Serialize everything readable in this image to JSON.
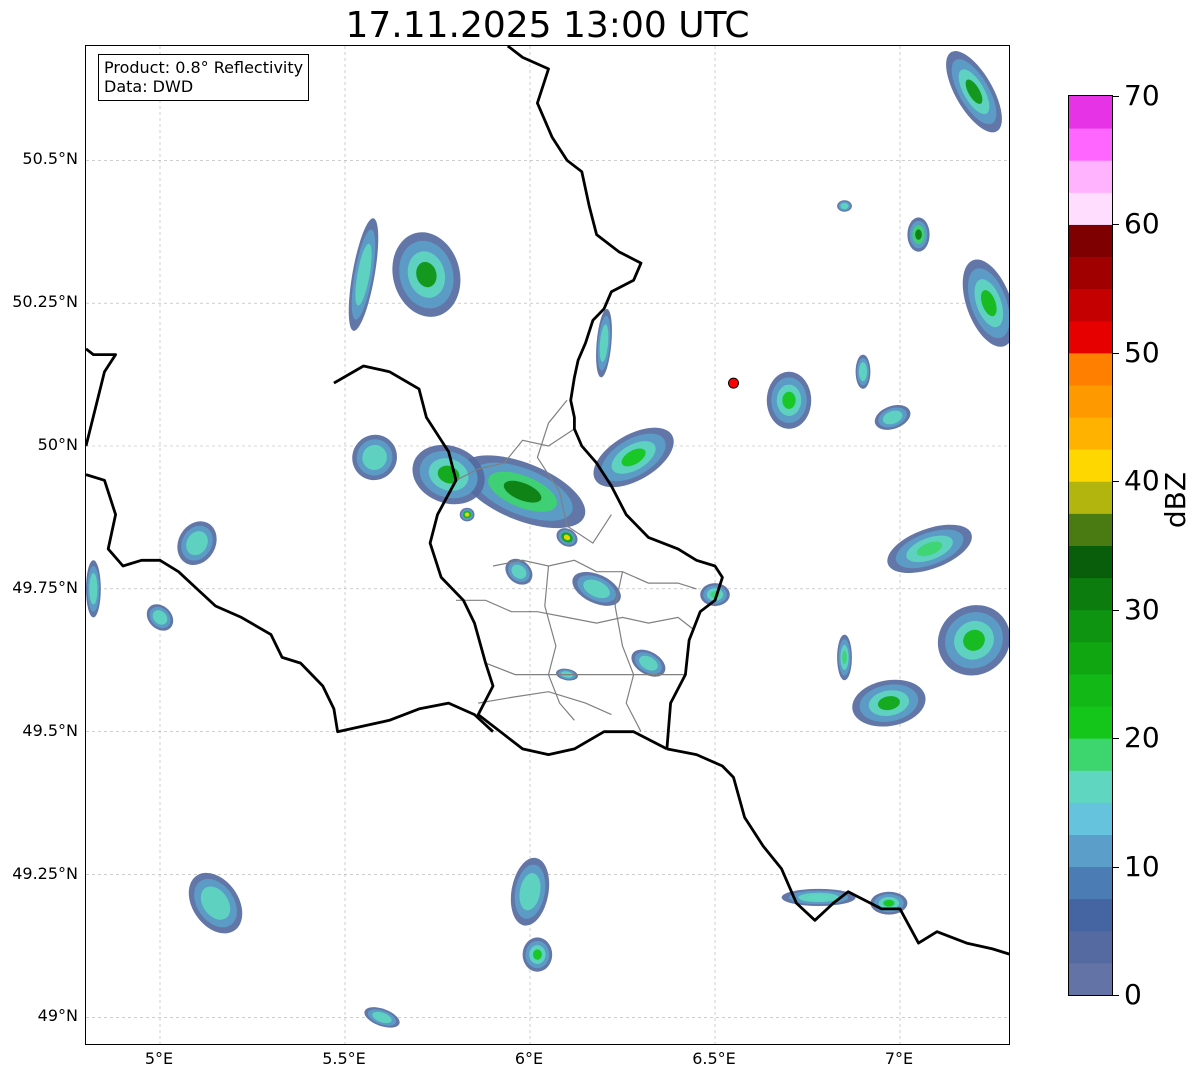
{
  "title": "17.11.2025 13:00 UTC",
  "info": {
    "product": "Product: 0.8° Reflectivity",
    "source": "Data: DWD"
  },
  "map": {
    "extent": {
      "lon": [
        4.8,
        7.3
      ],
      "lat": [
        48.95,
        50.7
      ]
    },
    "lat_ticks": [
      {
        "value": 49.0,
        "label": "49°N"
      },
      {
        "value": 49.25,
        "label": "49.25°N"
      },
      {
        "value": 49.5,
        "label": "49.5°N"
      },
      {
        "value": 49.75,
        "label": "49.75°N"
      },
      {
        "value": 50.0,
        "label": "50°N"
      },
      {
        "value": 50.25,
        "label": "50.25°N"
      },
      {
        "value": 50.5,
        "label": "50.5°N"
      }
    ],
    "lon_ticks": [
      {
        "value": 5.0,
        "label": "5°E"
      },
      {
        "value": 5.5,
        "label": "5.5°E"
      },
      {
        "value": 6.0,
        "label": "6°E"
      },
      {
        "value": 6.5,
        "label": "6.5°E"
      },
      {
        "value": 7.0,
        "label": "7°E"
      }
    ],
    "grid": true,
    "radar_site": {
      "lon": 6.55,
      "lat": 50.11,
      "color": "#ff0000"
    },
    "border_color": "#000000",
    "district_color": "#808080"
  },
  "colorbar": {
    "label": "dBZ",
    "min": 0,
    "max": 70,
    "step": 2.5,
    "tick_labels": [
      "0",
      "10",
      "20",
      "30",
      "40",
      "50",
      "60",
      "70"
    ],
    "colors": [
      "#6473a6",
      "#556aa0",
      "#4564a2",
      "#4c7cb4",
      "#5a9ec9",
      "#66c3de",
      "#5fd6c0",
      "#3dd56e",
      "#14c61a",
      "#12b815",
      "#10a612",
      "#0e9410",
      "#0c7c0e",
      "#095e0b",
      "#4a7a12",
      "#b1b50d",
      "#ffd700",
      "#ffb300",
      "#ff9900",
      "#ff7f00",
      "#e60000",
      "#c40000",
      "#a10000",
      "#7f0000",
      "#ffddff",
      "#ffb3ff",
      "#ff66ff",
      "#e633e6"
    ]
  },
  "echoes": [
    {
      "lon": 5.72,
      "lat": 50.3,
      "rx": 0.09,
      "ry": 0.075,
      "angle": -15,
      "intensity": 28
    },
    {
      "lon": 5.55,
      "lat": 50.3,
      "rx": 0.03,
      "ry": 0.1,
      "angle": 10,
      "intensity": 12
    },
    {
      "lon": 5.98,
      "lat": 49.92,
      "rx": 0.18,
      "ry": 0.05,
      "angle": 22,
      "intensity": 30
    },
    {
      "lon": 5.78,
      "lat": 49.95,
      "rx": 0.1,
      "ry": 0.05,
      "angle": 20,
      "intensity": 27
    },
    {
      "lon": 5.83,
      "lat": 49.88,
      "rx": 0.02,
      "ry": 0.012,
      "angle": 0,
      "intensity": 41
    },
    {
      "lon": 6.1,
      "lat": 49.84,
      "rx": 0.03,
      "ry": 0.015,
      "angle": 30,
      "intensity": 42
    },
    {
      "lon": 6.18,
      "lat": 49.75,
      "rx": 0.07,
      "ry": 0.025,
      "angle": 25,
      "intensity": 16
    },
    {
      "lon": 5.97,
      "lat": 49.78,
      "rx": 0.04,
      "ry": 0.02,
      "angle": 40,
      "intensity": 15
    },
    {
      "lon": 5.58,
      "lat": 49.98,
      "rx": 0.06,
      "ry": 0.04,
      "angle": 30,
      "intensity": 13
    },
    {
      "lon": 6.28,
      "lat": 49.98,
      "rx": 0.12,
      "ry": 0.04,
      "angle": -30,
      "intensity": 20
    },
    {
      "lon": 6.2,
      "lat": 50.18,
      "rx": 0.02,
      "ry": 0.06,
      "angle": 5,
      "intensity": 12
    },
    {
      "lon": 6.7,
      "lat": 50.08,
      "rx": 0.06,
      "ry": 0.05,
      "angle": 0,
      "intensity": 20
    },
    {
      "lon": 7.05,
      "lat": 50.37,
      "rx": 0.03,
      "ry": 0.03,
      "angle": 0,
      "intensity": 30
    },
    {
      "lon": 7.24,
      "lat": 50.25,
      "rx": 0.06,
      "ry": 0.08,
      "angle": -20,
      "intensity": 24
    },
    {
      "lon": 7.2,
      "lat": 50.62,
      "rx": 0.05,
      "ry": 0.08,
      "angle": -30,
      "intensity": 28
    },
    {
      "lon": 7.08,
      "lat": 49.82,
      "rx": 0.12,
      "ry": 0.035,
      "angle": -20,
      "intensity": 18
    },
    {
      "lon": 6.97,
      "lat": 49.55,
      "rx": 0.1,
      "ry": 0.04,
      "angle": -10,
      "intensity": 26
    },
    {
      "lon": 7.2,
      "lat": 49.66,
      "rx": 0.1,
      "ry": 0.06,
      "angle": -35,
      "intensity": 24
    },
    {
      "lon": 6.85,
      "lat": 49.63,
      "rx": 0.02,
      "ry": 0.04,
      "angle": 0,
      "intensity": 18
    },
    {
      "lon": 5.15,
      "lat": 49.2,
      "rx": 0.09,
      "ry": 0.04,
      "angle": 55,
      "intensity": 13
    },
    {
      "lon": 6.0,
      "lat": 49.22,
      "rx": 0.05,
      "ry": 0.06,
      "angle": 10,
      "intensity": 13
    },
    {
      "lon": 6.02,
      "lat": 49.11,
      "rx": 0.04,
      "ry": 0.03,
      "angle": 0,
      "intensity": 20
    },
    {
      "lon": 5.6,
      "lat": 49.0,
      "rx": 0.05,
      "ry": 0.015,
      "angle": 20,
      "intensity": 12
    },
    {
      "lon": 6.78,
      "lat": 49.21,
      "rx": 0.1,
      "ry": 0.015,
      "angle": 0,
      "intensity": 17
    },
    {
      "lon": 6.97,
      "lat": 49.2,
      "rx": 0.05,
      "ry": 0.02,
      "angle": 0,
      "intensity": 20
    },
    {
      "lon": 5.1,
      "lat": 49.83,
      "rx": 0.05,
      "ry": 0.04,
      "angle": 30,
      "intensity": 9
    },
    {
      "lon": 6.5,
      "lat": 49.74,
      "rx": 0.04,
      "ry": 0.02,
      "angle": 0,
      "intensity": 18
    },
    {
      "lon": 6.32,
      "lat": 49.62,
      "rx": 0.05,
      "ry": 0.02,
      "angle": 30,
      "intensity": 14
    },
    {
      "lon": 5.0,
      "lat": 49.7,
      "rx": 0.04,
      "ry": 0.02,
      "angle": 45,
      "intensity": 10
    },
    {
      "lon": 4.82,
      "lat": 49.75,
      "rx": 0.02,
      "ry": 0.05,
      "angle": 0,
      "intensity": 14
    },
    {
      "lon": 6.1,
      "lat": 49.6,
      "rx": 0.03,
      "ry": 0.01,
      "angle": 10,
      "intensity": 10
    },
    {
      "lon": 6.9,
      "lat": 50.13,
      "rx": 0.02,
      "ry": 0.03,
      "angle": 0,
      "intensity": 10
    },
    {
      "lon": 6.98,
      "lat": 50.05,
      "rx": 0.05,
      "ry": 0.02,
      "angle": -20,
      "intensity": 11
    },
    {
      "lon": 6.85,
      "lat": 50.42,
      "rx": 0.02,
      "ry": 0.01,
      "angle": 0,
      "intensity": 9
    }
  ],
  "borders": [
    [
      [
        5.94,
        50.7
      ],
      [
        5.98,
        50.68
      ],
      [
        6.05,
        50.66
      ],
      [
        6.02,
        50.6
      ],
      [
        6.06,
        50.54
      ],
      [
        6.1,
        50.5
      ],
      [
        6.14,
        50.48
      ],
      [
        6.16,
        50.42
      ],
      [
        6.18,
        50.37
      ],
      [
        6.24,
        50.34
      ],
      [
        6.3,
        50.32
      ],
      [
        6.28,
        50.29
      ],
      [
        6.22,
        50.27
      ],
      [
        6.2,
        50.24
      ],
      [
        6.17,
        50.22
      ],
      [
        6.15,
        50.18
      ],
      [
        6.13,
        50.15
      ],
      [
        6.12,
        50.12
      ],
      [
        6.11,
        50.08
      ],
      [
        6.12,
        50.05
      ],
      [
        6.12,
        50.03
      ],
      [
        6.14,
        50.0
      ],
      [
        6.18,
        49.97
      ],
      [
        6.22,
        49.93
      ],
      [
        6.26,
        49.88
      ],
      [
        6.32,
        49.84
      ],
      [
        6.4,
        49.82
      ],
      [
        6.45,
        49.8
      ],
      [
        6.5,
        49.79
      ],
      [
        6.52,
        49.77
      ],
      [
        6.5,
        49.73
      ],
      [
        6.46,
        49.71
      ],
      [
        6.43,
        49.66
      ],
      [
        6.42,
        49.6
      ],
      [
        6.38,
        49.55
      ],
      [
        6.37,
        49.47
      ]
    ],
    [
      [
        5.47,
        50.11
      ],
      [
        5.55,
        50.14
      ],
      [
        5.62,
        50.13
      ],
      [
        5.7,
        50.1
      ],
      [
        5.72,
        50.05
      ],
      [
        5.78,
        49.99
      ],
      [
        5.8,
        49.94
      ],
      [
        5.75,
        49.88
      ],
      [
        5.73,
        49.83
      ],
      [
        5.76,
        49.77
      ],
      [
        5.82,
        49.73
      ],
      [
        5.85,
        49.69
      ],
      [
        5.88,
        49.62
      ],
      [
        5.9,
        49.58
      ],
      [
        5.86,
        49.53
      ],
      [
        5.92,
        49.5
      ],
      [
        5.98,
        49.47
      ],
      [
        6.05,
        49.46
      ],
      [
        6.12,
        49.47
      ],
      [
        6.2,
        49.5
      ],
      [
        6.28,
        49.5
      ],
      [
        6.37,
        49.47
      ]
    ],
    [
      [
        4.8,
        50.17
      ],
      [
        4.82,
        50.16
      ],
      [
        4.88,
        50.16
      ],
      [
        4.85,
        50.13
      ],
      [
        4.8,
        50.0
      ]
    ],
    [
      [
        4.8,
        49.95
      ],
      [
        4.85,
        49.94
      ],
      [
        4.88,
        49.88
      ],
      [
        4.86,
        49.82
      ],
      [
        4.9,
        49.79
      ],
      [
        4.95,
        49.8
      ],
      [
        5.0,
        49.8
      ],
      [
        5.05,
        49.78
      ],
      [
        5.1,
        49.75
      ],
      [
        5.15,
        49.72
      ],
      [
        5.22,
        49.7
      ],
      [
        5.3,
        49.67
      ],
      [
        5.33,
        49.63
      ],
      [
        5.38,
        49.62
      ],
      [
        5.44,
        49.58
      ],
      [
        5.47,
        49.54
      ],
      [
        5.48,
        49.5
      ],
      [
        5.55,
        49.51
      ],
      [
        5.62,
        49.52
      ],
      [
        5.7,
        49.54
      ],
      [
        5.78,
        49.55
      ],
      [
        5.85,
        49.53
      ],
      [
        5.9,
        49.5
      ]
    ],
    [
      [
        6.37,
        49.47
      ],
      [
        6.45,
        49.46
      ],
      [
        6.52,
        49.44
      ],
      [
        6.55,
        49.42
      ],
      [
        6.58,
        49.35
      ],
      [
        6.63,
        49.3
      ],
      [
        6.68,
        49.26
      ],
      [
        6.72,
        49.2
      ],
      [
        6.77,
        49.17
      ],
      [
        6.82,
        49.2
      ],
      [
        6.86,
        49.22
      ],
      [
        6.92,
        49.2
      ],
      [
        6.95,
        49.19
      ],
      [
        7.0,
        49.19
      ],
      [
        7.05,
        49.13
      ],
      [
        7.1,
        49.15
      ],
      [
        7.18,
        49.13
      ],
      [
        7.25,
        49.12
      ],
      [
        7.3,
        49.11
      ]
    ]
  ],
  "districts": [
    [
      [
        6.12,
        50.03
      ],
      [
        6.05,
        50.0
      ],
      [
        5.98,
        50.01
      ],
      [
        5.93,
        49.97
      ],
      [
        5.86,
        49.96
      ],
      [
        5.8,
        49.94
      ]
    ],
    [
      [
        6.1,
        50.08
      ],
      [
        6.05,
        50.04
      ],
      [
        6.02,
        49.98
      ],
      [
        6.08,
        49.92
      ],
      [
        6.1,
        49.86
      ],
      [
        6.17,
        49.83
      ],
      [
        6.22,
        49.88
      ]
    ],
    [
      [
        5.9,
        49.79
      ],
      [
        5.98,
        49.8
      ],
      [
        6.05,
        49.79
      ],
      [
        6.12,
        49.8
      ],
      [
        6.18,
        49.78
      ],
      [
        6.25,
        49.78
      ],
      [
        6.32,
        49.76
      ],
      [
        6.4,
        49.76
      ],
      [
        6.45,
        49.75
      ]
    ],
    [
      [
        5.8,
        49.73
      ],
      [
        5.88,
        49.73
      ],
      [
        5.95,
        49.71
      ],
      [
        6.02,
        49.71
      ],
      [
        6.1,
        49.7
      ],
      [
        6.18,
        49.69
      ],
      [
        6.25,
        49.7
      ],
      [
        6.32,
        49.69
      ],
      [
        6.4,
        49.7
      ],
      [
        6.44,
        49.68
      ]
    ],
    [
      [
        6.05,
        49.79
      ],
      [
        6.04,
        49.72
      ],
      [
        6.07,
        49.65
      ],
      [
        6.05,
        49.6
      ],
      [
        6.08,
        49.55
      ],
      [
        6.12,
        49.52
      ]
    ],
    [
      [
        6.25,
        49.78
      ],
      [
        6.23,
        49.72
      ],
      [
        6.25,
        49.65
      ],
      [
        6.28,
        49.6
      ],
      [
        6.26,
        49.55
      ],
      [
        6.3,
        49.5
      ]
    ],
    [
      [
        5.88,
        49.62
      ],
      [
        5.96,
        49.6
      ],
      [
        6.05,
        49.6
      ],
      [
        6.15,
        49.6
      ],
      [
        6.25,
        49.6
      ],
      [
        6.35,
        49.6
      ],
      [
        6.42,
        49.6
      ]
    ],
    [
      [
        5.86,
        49.55
      ],
      [
        5.95,
        49.56
      ],
      [
        6.05,
        49.57
      ],
      [
        6.15,
        49.55
      ],
      [
        6.22,
        49.53
      ]
    ]
  ]
}
